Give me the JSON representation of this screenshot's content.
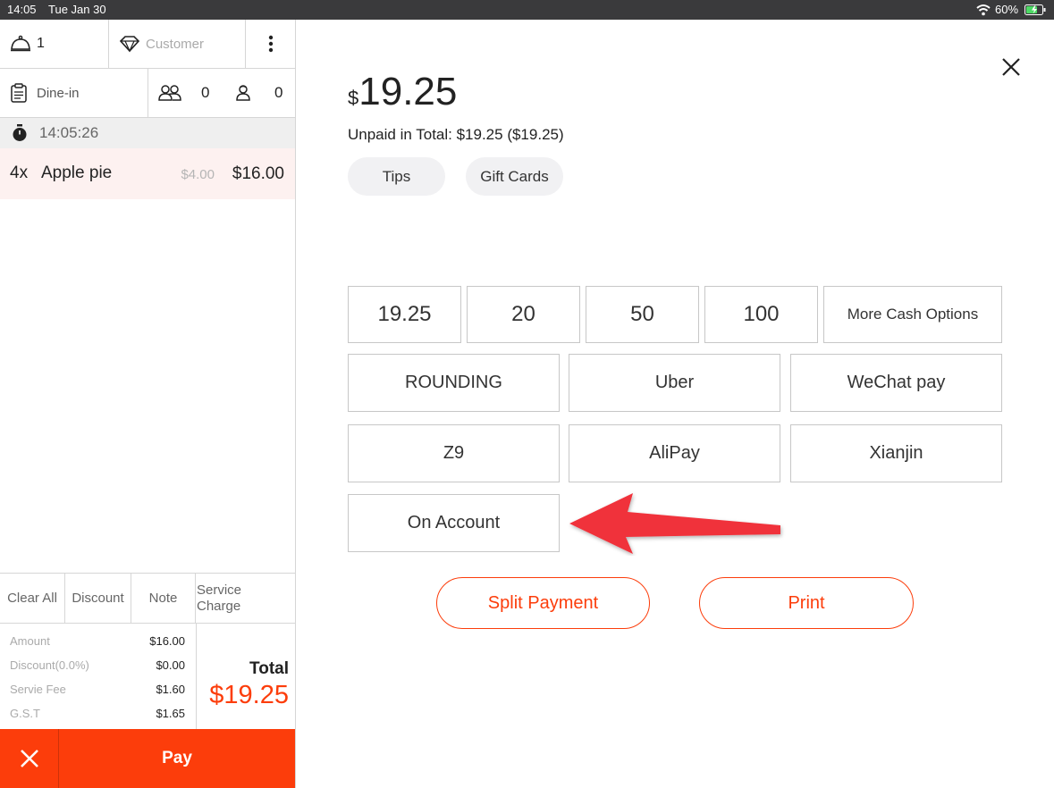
{
  "status_bar": {
    "time": "14:05",
    "date": "Tue Jan 30",
    "battery": "60%"
  },
  "order_header": {
    "table_number": "1",
    "customer_placeholder": "Customer",
    "order_type": "Dine-in",
    "adults": "0",
    "children": "0"
  },
  "order_timer": "14:05:26",
  "order_items": [
    {
      "qty": "4x",
      "name": "Apple pie",
      "unit_price": "$4.00",
      "line_total": "$16.00"
    }
  ],
  "order_actions": {
    "clear_all": "Clear All",
    "discount": "Discount",
    "note": "Note",
    "service_charge": "Service Charge"
  },
  "summary": [
    {
      "label": "Amount",
      "value": "$16.00"
    },
    {
      "label": "Discount(0.0%)",
      "value": "$0.00"
    },
    {
      "label": "Servie Fee",
      "value": "$1.60"
    },
    {
      "label": "G.S.T",
      "value": "$1.65"
    }
  ],
  "total": {
    "label": "Total",
    "value": "$19.25"
  },
  "pay_button": "Pay",
  "payment": {
    "currency_symbol": "$",
    "amount": "19.25",
    "unpaid_text": "Unpaid in Total: $19.25 ($19.25)",
    "tips_label": "Tips",
    "gift_cards_label": "Gift Cards",
    "cash_options": [
      "19.25",
      "20",
      "50",
      "100"
    ],
    "more_cash_label": "More Cash Options",
    "methods": [
      "ROUNDING",
      "Uber",
      "WeChat pay",
      "Z9",
      "AliPay",
      "Xianjin",
      "On Account"
    ],
    "split_payment_label": "Split Payment",
    "print_label": "Print"
  },
  "colors": {
    "accent": "#fc3d0b",
    "annotation_arrow": "#f0313b",
    "order_row_bg": "#fdf1f0"
  }
}
